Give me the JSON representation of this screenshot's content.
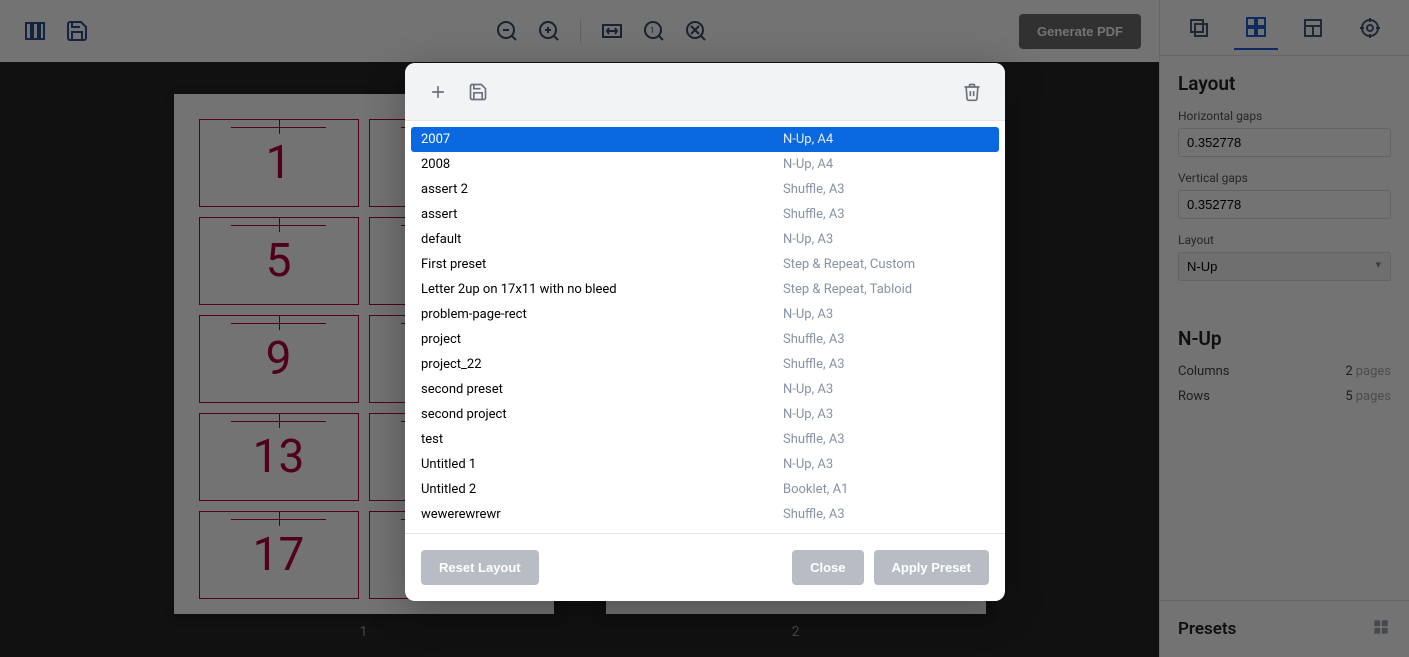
{
  "toolbar": {
    "generate_label": "Generate PDF"
  },
  "canvas": {
    "pages": [
      {
        "label": "1",
        "cells": [
          "1",
          "",
          "5",
          "",
          "9",
          "",
          "13",
          "",
          "17",
          ""
        ]
      },
      {
        "label": "2",
        "cells": [
          "",
          "",
          "",
          "",
          "",
          "",
          "",
          "",
          "",
          ""
        ]
      }
    ]
  },
  "sidebar": {
    "layout_title": "Layout",
    "hgap_label": "Horizontal gaps",
    "hgap_value": "0.352778",
    "vgap_label": "Vertical gaps",
    "vgap_value": "0.352778",
    "layout_label": "Layout",
    "layout_value": "N-Up",
    "nup_title": "N-Up",
    "cols_label": "Columns",
    "cols_value": "2",
    "rows_label": "Rows",
    "rows_value": "5",
    "pages_unit": "pages",
    "presets_title": "Presets"
  },
  "modal": {
    "presets": [
      {
        "name": "2007",
        "meta": "N-Up, A4",
        "selected": true
      },
      {
        "name": "2008",
        "meta": "N-Up, A4"
      },
      {
        "name": "assert 2",
        "meta": "Shuffle, A3"
      },
      {
        "name": "assert",
        "meta": "Shuffle, A3"
      },
      {
        "name": "default",
        "meta": "N-Up, A3"
      },
      {
        "name": "First preset",
        "meta": "Step & Repeat, Custom"
      },
      {
        "name": "Letter 2up on 17x11 with no bleed",
        "meta": "Step & Repeat, Tabloid"
      },
      {
        "name": "problem-page-rect",
        "meta": "N-Up, A3"
      },
      {
        "name": "project",
        "meta": "Shuffle, A3"
      },
      {
        "name": "project_22",
        "meta": "Shuffle, A3"
      },
      {
        "name": "second preset",
        "meta": "N-Up, A3"
      },
      {
        "name": "second project",
        "meta": "N-Up, A3"
      },
      {
        "name": "test",
        "meta": "Shuffle, A3"
      },
      {
        "name": "Untitled 1",
        "meta": "N-Up, A3"
      },
      {
        "name": "Untitled 2",
        "meta": "Booklet, A1"
      },
      {
        "name": "wewerewrewr",
        "meta": "Shuffle, A3"
      }
    ],
    "reset_label": "Reset Layout",
    "close_label": "Close",
    "apply_label": "Apply Preset"
  }
}
